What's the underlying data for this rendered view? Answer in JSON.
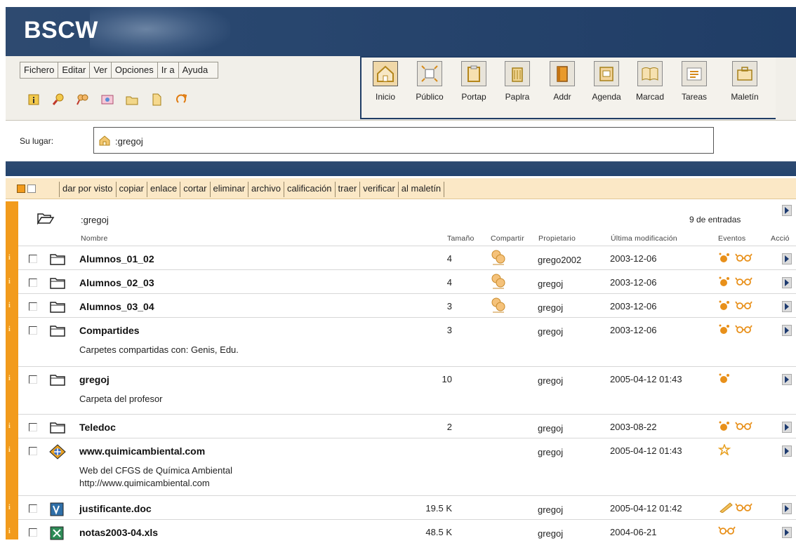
{
  "app": {
    "logo": "BSCW"
  },
  "menu": [
    "Fichero",
    "Editar",
    "Ver",
    "Opciones",
    "Ir a",
    "Ayuda"
  ],
  "toolbar": {
    "small_icons": [
      "info-icon",
      "search-icon",
      "search-people-icon",
      "add-url-icon",
      "new-folder-icon",
      "new-document-icon",
      "refresh-icon"
    ],
    "big_buttons": [
      {
        "label": "Inicio",
        "icon": "home-icon",
        "active": true
      },
      {
        "label": "Público",
        "icon": "public-icon"
      },
      {
        "label": "Portap",
        "icon": "clipboard-icon"
      },
      {
        "label": "Paplra",
        "icon": "trash-icon"
      },
      {
        "label": "Addr",
        "icon": "address-book-icon"
      },
      {
        "label": "Agenda",
        "icon": "calendar-icon"
      },
      {
        "label": "Marcad",
        "icon": "bookmarks-icon"
      },
      {
        "label": "Tareas",
        "icon": "tasks-icon"
      },
      {
        "label": "Maletín",
        "icon": "briefcase-icon"
      }
    ]
  },
  "location": {
    "label": "Su lugar:",
    "path": ":gregoj"
  },
  "actions": [
    "dar por visto",
    "copiar",
    "enlace",
    "cortar",
    "eliminar",
    "archivo",
    "calificación",
    "traer",
    "verificar",
    "al maletín"
  ],
  "listing": {
    "title": ":gregoj",
    "count": "9 de entradas",
    "columns": {
      "name": "Nombre",
      "size": "Tamaño",
      "share": "Compartir",
      "owner": "Propietario",
      "modified": "Última modificación",
      "events": "Eventos",
      "actions": "Acció"
    },
    "rows": [
      {
        "name": "Alumnos_01_02",
        "type": "folder",
        "size": "4",
        "shared": true,
        "owner": "grego2002",
        "modified": "2003-12-06",
        "events": [
          "new-event-icon",
          "read-event-icon"
        ],
        "desc": []
      },
      {
        "name": "Alumnos_02_03",
        "type": "folder",
        "size": "4",
        "shared": true,
        "owner": "gregoj",
        "modified": "2003-12-06",
        "events": [
          "new-event-icon",
          "read-event-icon"
        ],
        "desc": []
      },
      {
        "name": "Alumnos_03_04",
        "type": "folder",
        "size": "3",
        "shared": true,
        "owner": "gregoj",
        "modified": "2003-12-06",
        "events": [
          "new-event-icon",
          "read-event-icon"
        ],
        "desc": []
      },
      {
        "name": "Compartides",
        "type": "folder",
        "size": "3",
        "shared": false,
        "owner": "gregoj",
        "modified": "2003-12-06",
        "events": [
          "new-event-icon",
          "read-event-icon"
        ],
        "desc": [
          "Carpetes compartidas con: Genis, Edu."
        ]
      },
      {
        "name": "gregoj",
        "type": "folder",
        "size": "10",
        "shared": false,
        "owner": "gregoj",
        "modified": "2005-04-12 01:43",
        "events": [
          "new-event-icon"
        ],
        "desc": [
          "Carpeta del profesor"
        ]
      },
      {
        "name": "Teledoc",
        "type": "folder",
        "size": "2",
        "shared": false,
        "owner": "gregoj",
        "modified": "2003-08-22",
        "events": [
          "new-event-icon",
          "read-event-icon"
        ],
        "desc": []
      },
      {
        "name": "www.quimicambiental.com",
        "type": "url",
        "size": "",
        "shared": false,
        "owner": "gregoj",
        "modified": "2005-04-12 01:43",
        "events": [
          "star-event-icon"
        ],
        "desc": [
          "Web del CFGS de Química Ambiental",
          "http://www.quimicambiental.com"
        ]
      },
      {
        "name": "justificante.doc",
        "type": "doc",
        "size": "19.5 K",
        "shared": false,
        "owner": "gregoj",
        "modified": "2005-04-12 01:42",
        "events": [
          "edit-event-icon",
          "read-event-icon"
        ],
        "desc": []
      },
      {
        "name": "notas2003-04.xls",
        "type": "xls",
        "size": "48.5 K",
        "shared": false,
        "owner": "gregoj",
        "modified": "2004-06-21",
        "events": [
          "read-event-icon"
        ],
        "desc": []
      }
    ]
  },
  "colors": {
    "banner": "#24446e",
    "accent": "#f29b1c",
    "actionbar": "#fbe8c6"
  }
}
